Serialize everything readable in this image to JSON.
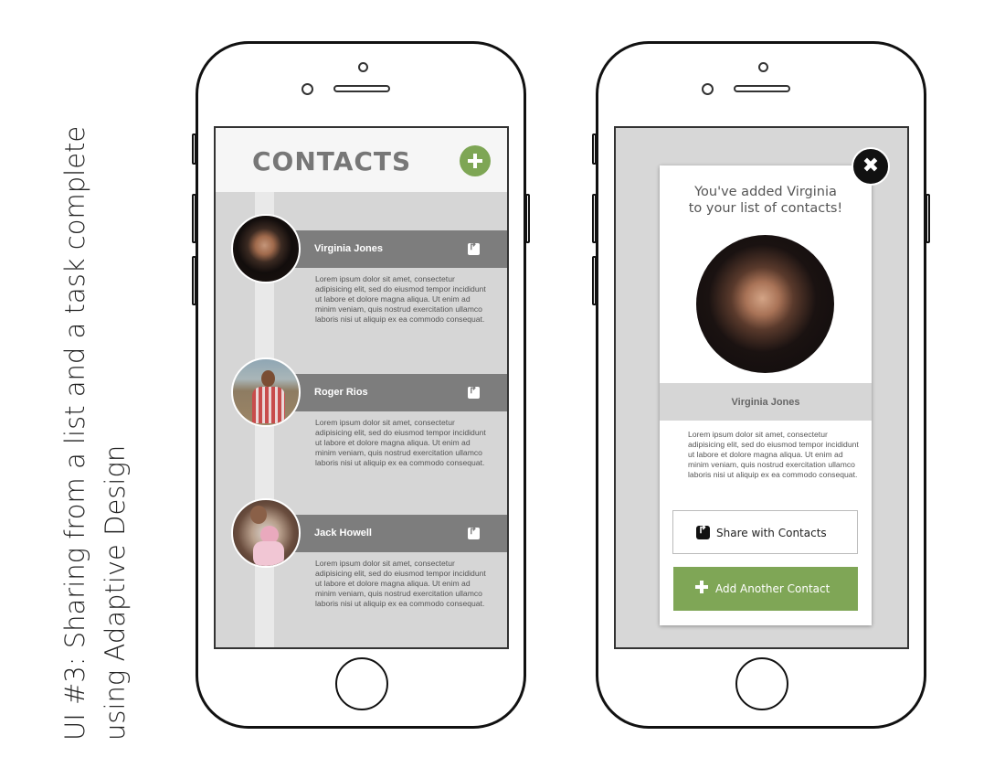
{
  "caption": {
    "line1": "UI #3: Sharing from a list and a task complete",
    "line2": "using Adaptive Design"
  },
  "list_screen": {
    "title": "CONTACTS",
    "add_icon": "plus-circle-icon",
    "accent_color": "#7ea655",
    "contacts": [
      {
        "name": "Virginia Jones",
        "description": "Lorem ipsum dolor sit amet, consectetur adipisicing elit, sed do eiusmod tempor incididunt ut labore et dolore magna aliqua. Ut enim ad minim veniam, quis nostrud exercitation ullamco laboris nisi ut aliquip ex ea commodo consequat."
      },
      {
        "name": "Roger Rios",
        "description": "Lorem ipsum dolor sit amet, consectetur adipisicing elit, sed do eiusmod tempor incididunt ut labore et dolore magna aliqua. Ut enim ad minim veniam, quis nostrud exercitation ullamco laboris nisi ut aliquip ex ea commodo consequat."
      },
      {
        "name": "Jack Howell",
        "description": "Lorem ipsum dolor sit amet, consectetur adipisicing elit, sed do eiusmod tempor incididunt ut labore et dolore magna aliqua. Ut enim ad minim veniam, quis nostrud exercitation ullamco laboris nisi ut aliquip ex ea commodo consequat."
      }
    ]
  },
  "modal_screen": {
    "message_line1": "You've added Virginia",
    "message_line2": "to your list of contacts!",
    "contact_name": "Virginia Jones",
    "description": "Lorem ipsum dolor sit amet, consectetur adipisicing elit, sed do eiusmod tempor incididunt ut labore et dolore magna aliqua. Ut enim ad minim veniam, quis nostrud exercitation ullamco laboris nisi ut aliquip ex ea commodo consequat.",
    "share_label": "Share with Contacts",
    "add_label": "Add Another Contact",
    "close_icon": "close-icon",
    "button_color": "#7fa656"
  }
}
